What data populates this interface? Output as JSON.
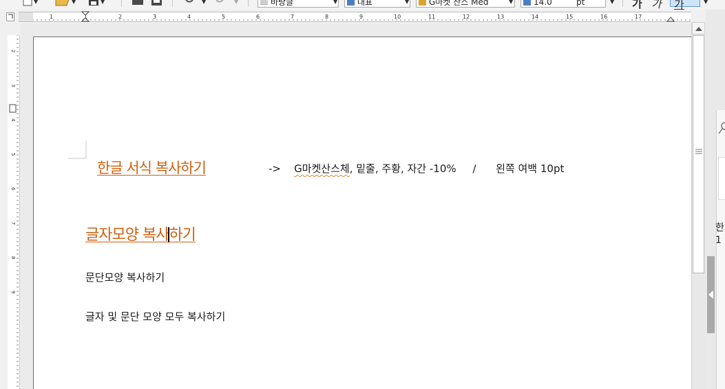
{
  "toolbar": {
    "style_value": "바탕글",
    "lang_value": "대표",
    "font_value": "G마켓 산스 Med",
    "size_value": "14.0",
    "size_unit": "pt",
    "bold_label": "가",
    "italic_label": "가",
    "underline_label": "가"
  },
  "ruler": {
    "h_marks": [
      "1",
      "1",
      "2",
      "3",
      "4",
      "5",
      "6",
      "7",
      "8",
      "9",
      "10",
      "11",
      "12",
      "13",
      "14",
      "15",
      "16",
      "17"
    ],
    "v_marks": [
      "2",
      "3",
      "4",
      "5",
      "6",
      "7",
      "8",
      "9"
    ]
  },
  "document": {
    "line1_title": "한글 서식 복사하기",
    "line1_arrow": "->",
    "line1_font_word": "G마켓산스체",
    "line1_rest": ", 밑줄, 주황, 자간 -10%",
    "line1_slash": "/",
    "line1_margin": "왼쪽 여백 10pt",
    "line2_a": "글자모양 복사",
    "line2_b": "하기",
    "line3": "문단모양 복사하기",
    "line4": "글자 및 문단 모양 모두 복사하기"
  },
  "side_panel": {
    "char1": "한",
    "char2": "1"
  },
  "colors": {
    "accent_orange": "#d0600e",
    "page_bg": "#ffffff",
    "workspace_bg": "#ebebeb"
  }
}
